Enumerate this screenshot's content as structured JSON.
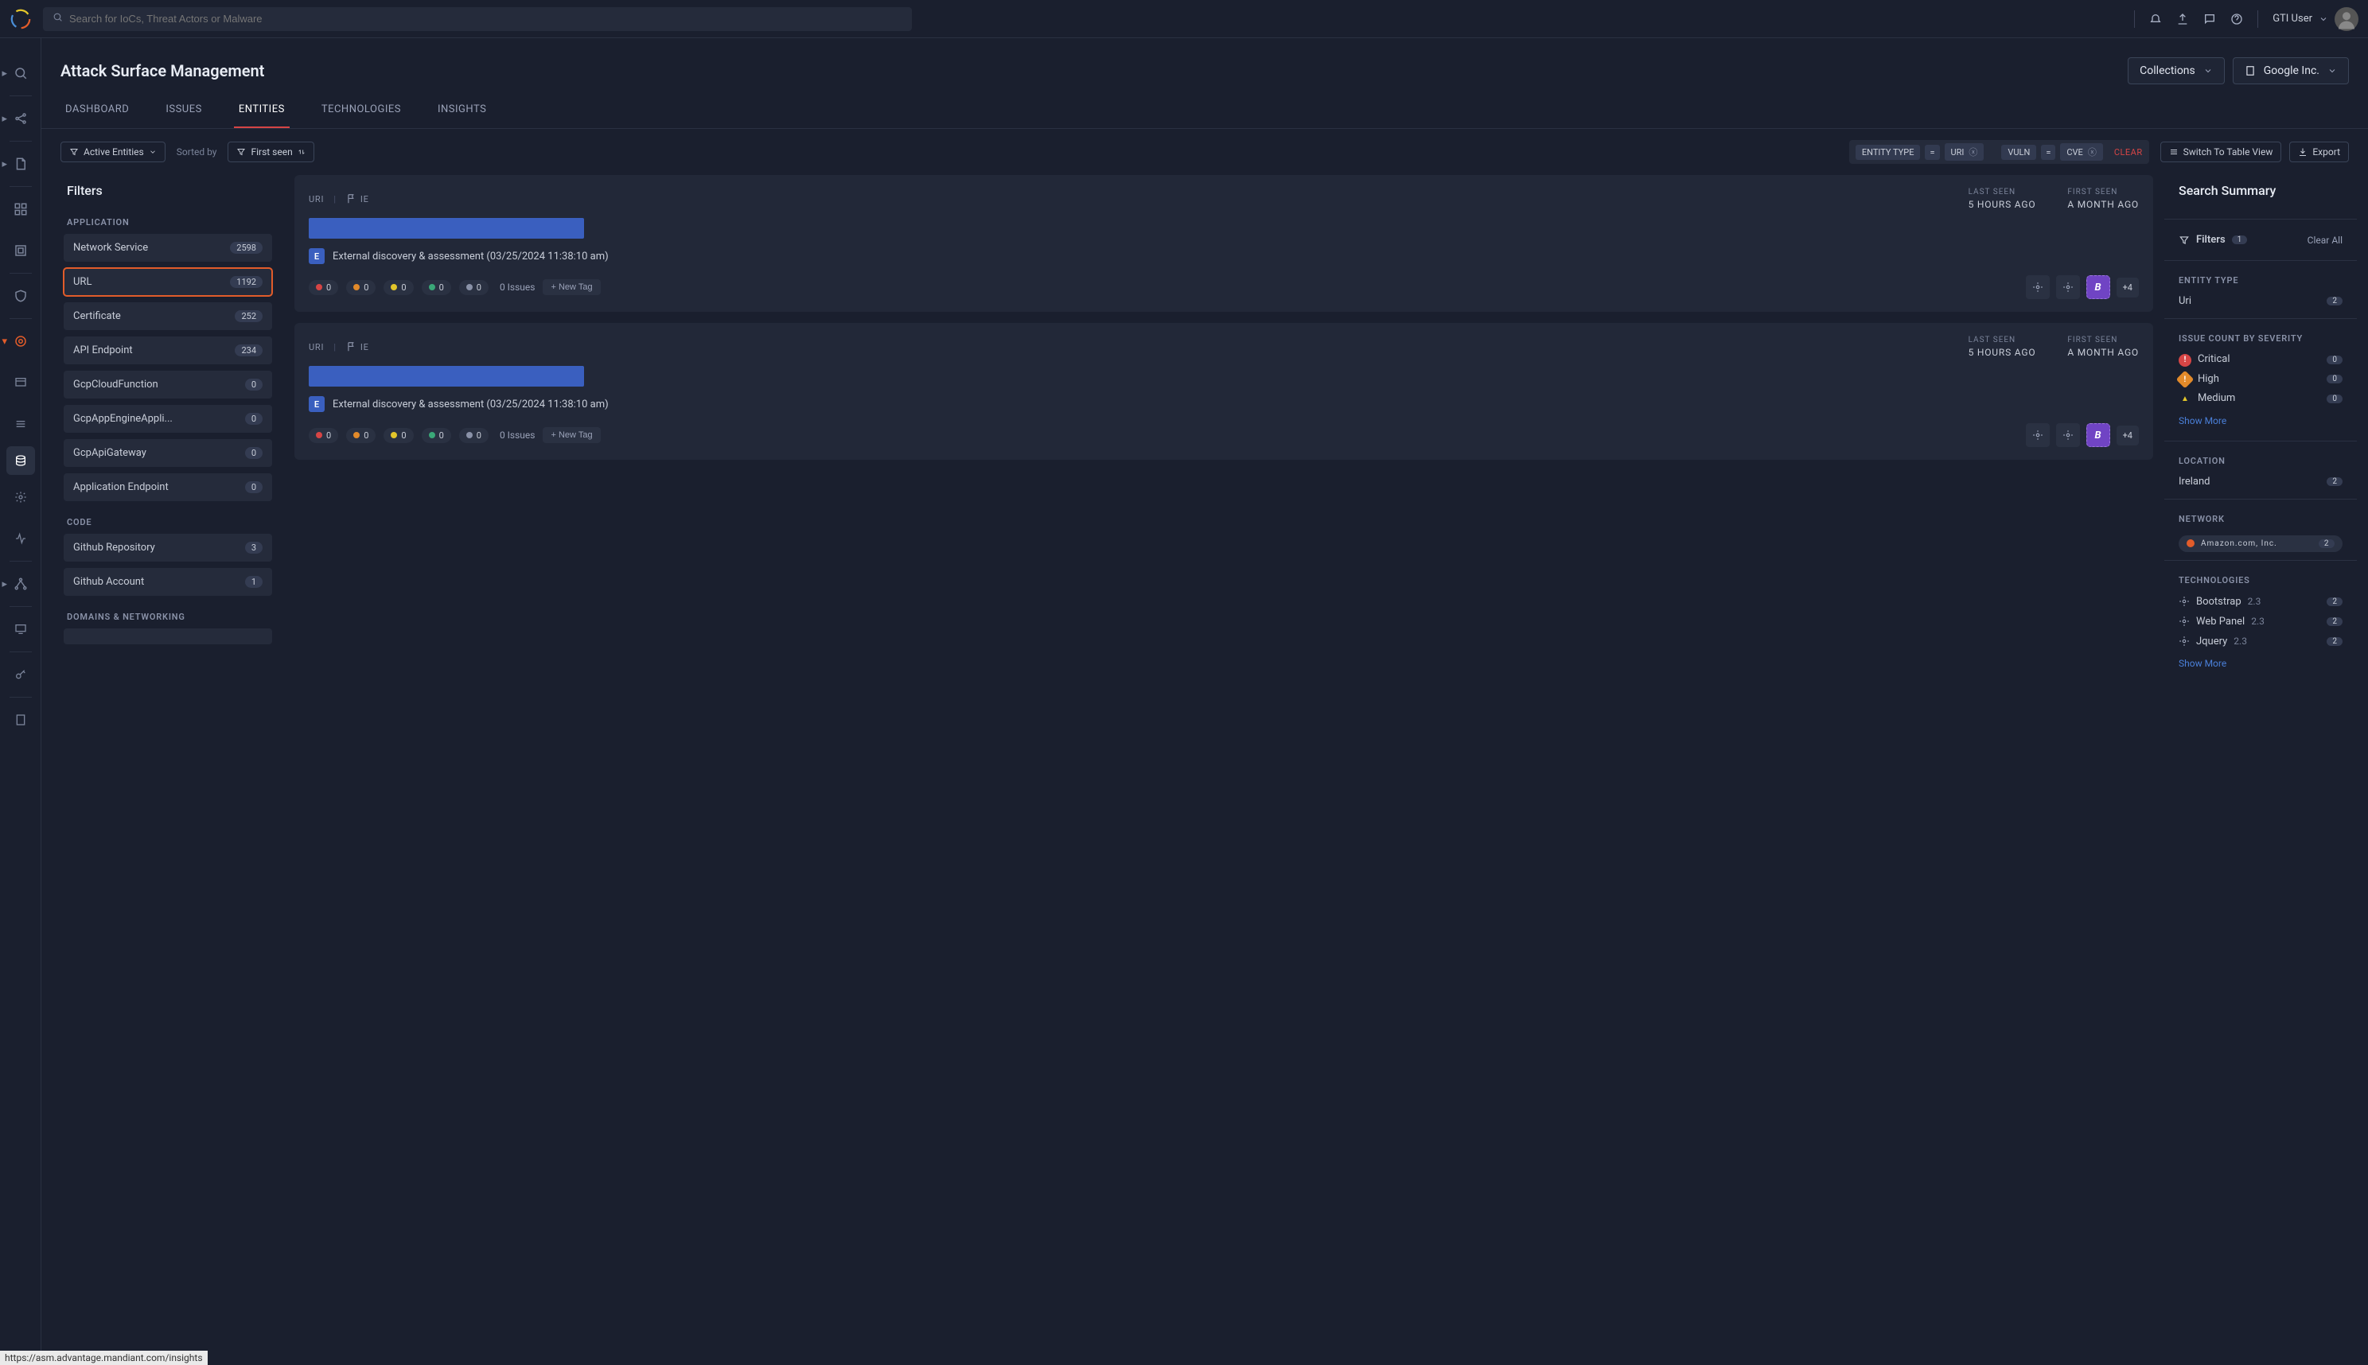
{
  "topbar": {
    "search_placeholder": "Search for IoCs, Threat Actors or Malware",
    "user_label": "GTI User"
  },
  "page": {
    "title": "Attack Surface Management",
    "collections_label": "Collections",
    "org_label": "Google Inc."
  },
  "tabs": {
    "dashboard": "DASHBOARD",
    "issues": "ISSUES",
    "entities": "ENTITIES",
    "technologies": "TECHNOLOGIES",
    "insights": "INSIGHTS"
  },
  "toolbar": {
    "active_entities": "Active Entities",
    "sorted_by": "Sorted by",
    "first_seen": "First seen",
    "chips": {
      "entity_type": "ENTITY TYPE",
      "eq": "=",
      "uri": "URI",
      "vuln": "VULN",
      "cve": "CVE"
    },
    "clear": "CLEAR",
    "switch_table": "Switch To Table View",
    "export": "Export"
  },
  "filters": {
    "title": "Filters",
    "sections": {
      "application": "APPLICATION",
      "code": "CODE",
      "domains": "DOMAINS & NETWORKING"
    },
    "application": [
      {
        "label": "Network Service",
        "count": "2598"
      },
      {
        "label": "URL",
        "count": "1192"
      },
      {
        "label": "Certificate",
        "count": "252"
      },
      {
        "label": "API Endpoint",
        "count": "234"
      },
      {
        "label": "GcpCloudFunction",
        "count": "0"
      },
      {
        "label": "GcpAppEngineAppli...",
        "count": "0"
      },
      {
        "label": "GcpApiGateway",
        "count": "0"
      },
      {
        "label": "Application Endpoint",
        "count": "0"
      }
    ],
    "code": [
      {
        "label": "Github Repository",
        "count": "3"
      },
      {
        "label": "Github Account",
        "count": "1"
      }
    ]
  },
  "results": [
    {
      "type": "URI",
      "flag": "IE",
      "last_seen_label": "LAST SEEN",
      "last_seen": "5 HOURS AGO",
      "first_seen_label": "FIRST SEEN",
      "first_seen": "A MONTH AGO",
      "discovery": "External discovery & assessment (03/25/2024 11:38:10 am)",
      "issues": "0 Issues",
      "new_tag": "+ New Tag",
      "plus": "+4",
      "sev": [
        "0",
        "0",
        "0",
        "0",
        "0"
      ]
    },
    {
      "type": "URI",
      "flag": "IE",
      "last_seen_label": "LAST SEEN",
      "last_seen": "5 HOURS AGO",
      "first_seen_label": "FIRST SEEN",
      "first_seen": "A MONTH AGO",
      "discovery": "External discovery & assessment (03/25/2024 11:38:10 am)",
      "issues": "0 Issues",
      "new_tag": "+ New Tag",
      "plus": "+4",
      "sev": [
        "0",
        "0",
        "0",
        "0",
        "0"
      ]
    }
  ],
  "summary": {
    "title": "Search Summary",
    "filters_label": "Filters",
    "filters_count": "1",
    "clear_all": "Clear All",
    "entity_type_label": "ENTITY TYPE",
    "entity_type": {
      "name": "Uri",
      "count": "2"
    },
    "issue_count_label": "ISSUE COUNT BY SEVERITY",
    "severities": [
      {
        "name": "Critical",
        "count": "0",
        "color": "#d64545"
      },
      {
        "name": "High",
        "count": "0",
        "color": "#e28a2a"
      },
      {
        "name": "Medium",
        "count": "0",
        "color": "#e2c52a"
      }
    ],
    "show_more": "Show More",
    "location_label": "LOCATION",
    "location": {
      "name": "Ireland",
      "count": "2"
    },
    "network_label": "NETWORK",
    "network": {
      "name": "Amazon.com, Inc.",
      "count": "2"
    },
    "technologies_label": "TECHNOLOGIES",
    "technologies": [
      {
        "name": "Bootstrap",
        "version": "2.3",
        "count": "2"
      },
      {
        "name": "Web Panel",
        "version": "2.3",
        "count": "2"
      },
      {
        "name": "Jquery",
        "version": "2.3",
        "count": "2"
      }
    ]
  },
  "status_url": "https://asm.advantage.mandiant.com/insights"
}
